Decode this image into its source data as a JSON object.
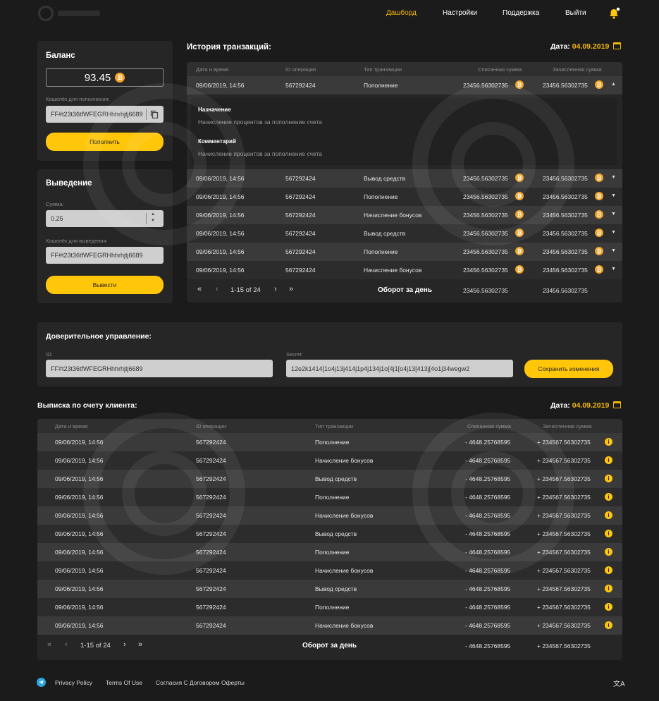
{
  "nav": {
    "items": [
      "Дашборд",
      "Настройки",
      "Поддержка",
      "Выйти"
    ],
    "active": 0
  },
  "balance": {
    "title": "Баланс",
    "amount": "93.45",
    "wallet_label": "Кошелёк для пополнения:",
    "wallet": "FF#t23t36tfWFEGRHhhrhjtj6689",
    "button": "Пополнить"
  },
  "withdraw": {
    "title": "Выведение",
    "sum_label": "Сумма:",
    "sum": "0.25",
    "wallet_label": "Кошелёк для выведения:",
    "wallet": "FF#t23t36tfWFEGRHhhrhjtj6689",
    "button": "Вывести"
  },
  "history": {
    "title": "История транзакций:",
    "date_label": "Дата:",
    "date": "04.09.2019",
    "columns": [
      "Дата и время",
      "ID операции",
      "Тип транзакции",
      "Списанная сумма",
      "Зачисленная сумма"
    ],
    "expanded": {
      "purpose_label": "Назначение",
      "purpose": "Начисление процентов за пополнение счета",
      "comment_label": "Комментарий",
      "comment": "Начисление процентов за пополнение счета"
    },
    "rows": [
      {
        "date": "09/06/2019, 14:56",
        "id": "567292424",
        "type": "Пополнение",
        "debit": "23456.56302735",
        "credit": "23456.56302735"
      },
      {
        "date": "09/06/2019, 14:56",
        "id": "567292424",
        "type": "Вывод средств",
        "debit": "23456.56302735",
        "credit": "23456.56302735"
      },
      {
        "date": "09/06/2019, 14:56",
        "id": "567292424",
        "type": "Пополнение",
        "debit": "23456.56302735",
        "credit": "23456.56302735"
      },
      {
        "date": "09/06/2019, 14:56",
        "id": "567292424",
        "type": "Начисление бонусов",
        "debit": "23456.56302735",
        "credit": "23456.56302735"
      },
      {
        "date": "09/06/2019, 14:56",
        "id": "567292424",
        "type": "Вывод средств",
        "debit": "23456.56302735",
        "credit": "23456.56302735"
      },
      {
        "date": "09/06/2019, 14:56",
        "id": "567292424",
        "type": "Пополнение",
        "debit": "23456.56302735",
        "credit": "23456.56302735"
      },
      {
        "date": "09/06/2019, 14:56",
        "id": "567292424",
        "type": "Начисление бонусов",
        "debit": "23456.56302735",
        "credit": "23456.56302735"
      }
    ],
    "pager": "1-15 of 24",
    "turnover_label": "Оборот за день",
    "turnover_debit": "23456.56302735",
    "turnover_credit": "23456.56302735"
  },
  "trust": {
    "title": "Доверительное управление:",
    "id_label": "ID:",
    "id": "FF#t23t36tfWFEGRHhhrhjtj6689",
    "secret_label": "Secret:",
    "secret": "12e2k1414[1o4j13j414j1p4j134j1o[4j1[o4j13[413j[4o1j34wegw2",
    "button": "Сохранить изменения"
  },
  "statement": {
    "title": "Выписка по счету клиента:",
    "date_label": "Дата:",
    "date": "04.09.2019",
    "columns": [
      "Дата и время",
      "ID операции",
      "Тип транзакции",
      "Списанная сумма",
      "Зачисленная сумма"
    ],
    "rows": [
      {
        "date": "09/06/2019, 14:56",
        "id": "567292424",
        "type": "Пополнение",
        "debit": "- 4648.25768595",
        "credit": "+ 234567.56302735"
      },
      {
        "date": "09/06/2019, 14:56",
        "id": "567292424",
        "type": "Начисление бонусов",
        "debit": "- 4648.25768595",
        "credit": "+ 234567.56302735"
      },
      {
        "date": "09/06/2019, 14:56",
        "id": "567292424",
        "type": "Вывод средств",
        "debit": "- 4648.25768595",
        "credit": "+ 234567.56302735"
      },
      {
        "date": "09/06/2019, 14:56",
        "id": "567292424",
        "type": "Пополнение",
        "debit": "- 4648.25768595",
        "credit": "+ 234567.56302735"
      },
      {
        "date": "09/06/2019, 14:56",
        "id": "567292424",
        "type": "Начисление бонусов",
        "debit": "- 4648.25768595",
        "credit": "+ 234567.56302735"
      },
      {
        "date": "09/06/2019, 14:56",
        "id": "567292424",
        "type": "Вывод средств",
        "debit": "- 4648.25768595",
        "credit": "+ 234567.56302735"
      },
      {
        "date": "09/06/2019, 14:56",
        "id": "567292424",
        "type": "Пополнение",
        "debit": "- 4648.25768595",
        "credit": "+ 234567.56302735"
      },
      {
        "date": "09/06/2019, 14:56",
        "id": "567292424",
        "type": "Начисление бонусов",
        "debit": "- 4648.25768595",
        "credit": "+ 234567.56302735"
      },
      {
        "date": "09/06/2019, 14:56",
        "id": "567292424",
        "type": "Вывод средств",
        "debit": "- 4648.25768595",
        "credit": "+ 234567.56302735"
      },
      {
        "date": "09/06/2019, 14:56",
        "id": "567292424",
        "type": "Пополнение",
        "debit": "- 4648.25768595",
        "credit": "+ 234567.56302735"
      },
      {
        "date": "09/06/2019, 14:56",
        "id": "567292424",
        "type": "Начисление бонусов",
        "debit": "- 4648.25768595",
        "credit": "+ 234567.56302735"
      }
    ],
    "pager": "1-15 of 24",
    "turnover_label": "Оборот за день",
    "turnover_debit": "- 4648.25768595",
    "turnover_credit": "+ 234567.56302735"
  },
  "footer": {
    "links": [
      "Privacy Policy",
      "Terms Of Use",
      "Согласия С Договором Оферты"
    ]
  },
  "colors": {
    "accent": "#ffc60a",
    "background": "#1b1b1c",
    "card": "#262627"
  }
}
